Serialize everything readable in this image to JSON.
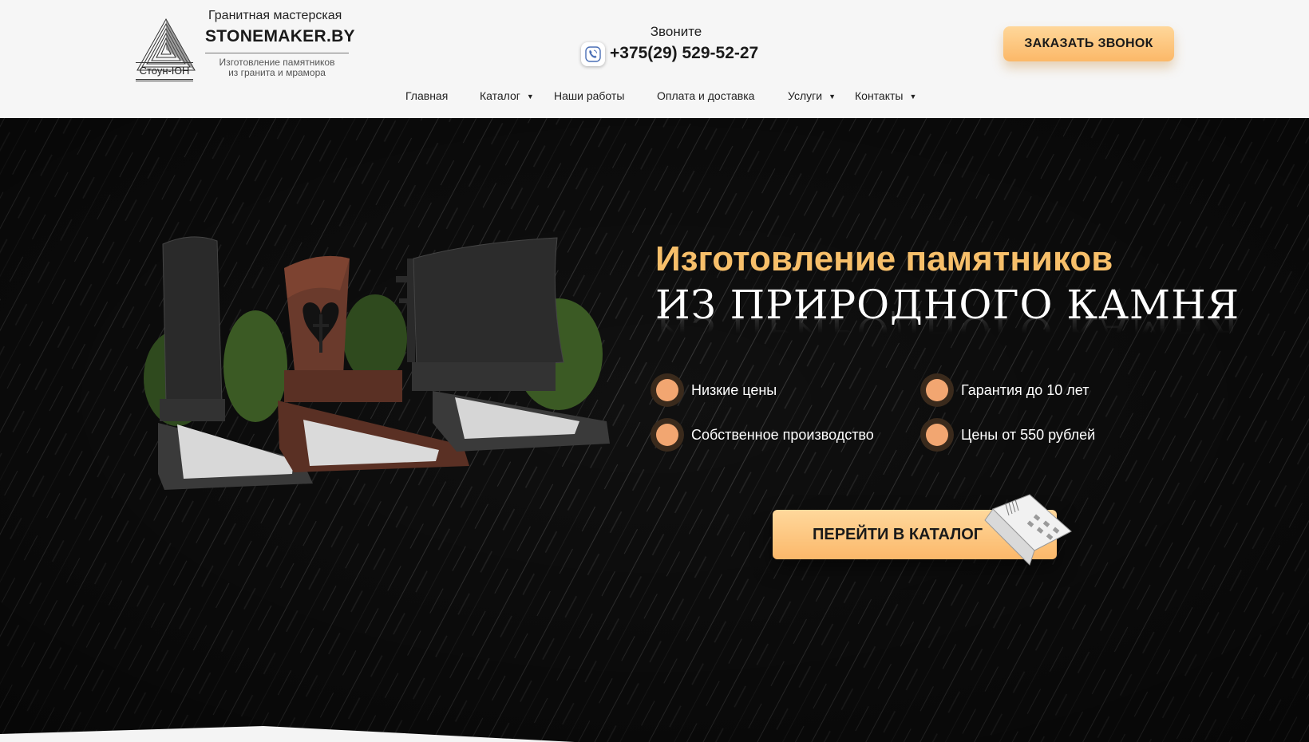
{
  "brand": {
    "logo_caption": "Стоун-ЮН",
    "subtitle": "Гранитная мастерская",
    "title": "STONEMAKER.BY",
    "description_line1": "Изготовление памятников",
    "description_line2": "из гранита и мрамора"
  },
  "contact": {
    "call_label": "Звоните",
    "phone": "+375(29) 529-52-27",
    "callback_button": "ЗАКАЗАТЬ ЗВОНОК"
  },
  "nav": {
    "items": [
      {
        "label": "Главная",
        "has_dropdown": false
      },
      {
        "label": "Каталог",
        "has_dropdown": true
      },
      {
        "label": "Наши работы",
        "has_dropdown": false
      },
      {
        "label": "Оплата и доставка",
        "has_dropdown": false
      },
      {
        "label": "Услуги",
        "has_dropdown": true
      },
      {
        "label": "Контакты",
        "has_dropdown": true
      }
    ],
    "caret_glyph": "▼"
  },
  "hero": {
    "headline_line1": "Изготовление памятников",
    "headline_line2": "ИЗ ПРИРОДНОГО КАМНЯ",
    "features": [
      "Низкие цены",
      "Гарантия до 10 лет",
      "Собственное производство",
      "Цены от 550 рублей"
    ],
    "catalog_button": "ПЕРЕЙТИ В КАТАЛОГ"
  },
  "colors": {
    "accent_gold": "#f7bf6a",
    "button_gradient_top": "#ffd89c",
    "button_gradient_bottom": "#fbb86a",
    "feature_dot": "#f2a671",
    "hero_background": "#0d0d0d",
    "header_background": "#f6f6f6"
  },
  "icons": {
    "logo": "pyramid-logo-icon",
    "phone": "phone-viber-icon",
    "nav_caret": "caret-down-icon",
    "feature_bullet": "orange-dot-icon"
  }
}
